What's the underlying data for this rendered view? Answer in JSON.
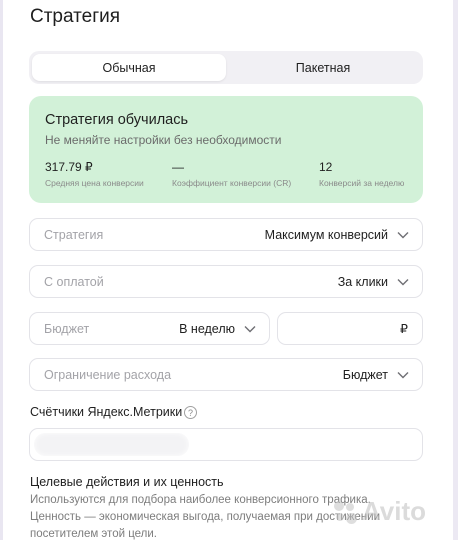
{
  "page_title": "Стратегия",
  "mode_tabs": [
    {
      "label": "Обычная",
      "active": true
    },
    {
      "label": "Пакетная",
      "active": false
    }
  ],
  "status_card": {
    "title": "Стратегия обучилась",
    "subtitle": "Не меняйте настройки без необходимости",
    "metrics": [
      {
        "value": "317.79 ₽",
        "label": "Средняя цена конверсии"
      },
      {
        "value": "—",
        "label": "Коэффициент конверсии (CR)"
      },
      {
        "value": "12",
        "label": "Конверсий за неделю"
      }
    ],
    "bg_color": "#d2f1d8"
  },
  "strategy_field": {
    "label": "Стратегия",
    "value": "Максимум конверсий"
  },
  "payment_field": {
    "label": "С оплатой",
    "value": "За клики"
  },
  "budget_field": {
    "label": "Бюджет",
    "period": "В неделю",
    "currency": "₽"
  },
  "limit_field": {
    "label": "Ограничение расхода",
    "value": "Бюджет"
  },
  "metrika": {
    "title": "Счётчики Яндекс.Метрики",
    "help": "?"
  },
  "goals": {
    "title": "Целевые действия и их ценность",
    "lines": [
      "Используются для подбора наиболее конверсионного трафика.",
      "Ценность — экономическая выгода, получаемая при достижении",
      "посетителем этой цели."
    ]
  },
  "watermark": "Avito"
}
